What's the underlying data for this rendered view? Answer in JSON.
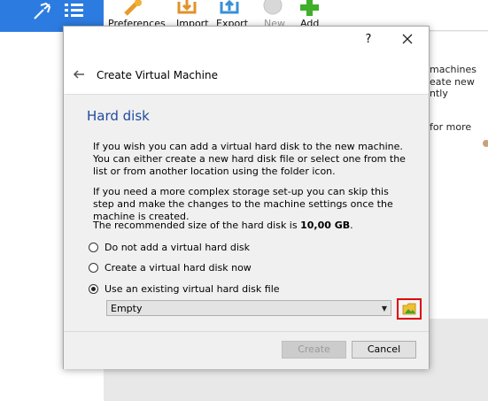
{
  "toolbar": {
    "preferences_label": "Preferences",
    "import_label": "Import",
    "export_label": "Export",
    "new_label": "New",
    "add_label": "Add"
  },
  "background_text": {
    "line1": "machines",
    "line2": "eate new",
    "line3": "ntly",
    "line4": "for more"
  },
  "dialog": {
    "help_label": "?",
    "wizard_title": "Create Virtual Machine",
    "section_title": "Hard disk",
    "paragraph1": "If you wish you can add a virtual hard disk to the new machine. You can either create a new hard disk file or select one from the list or from another location using the folder icon.",
    "paragraph2": "If you need a more complex storage set-up you can skip this step and make the changes to the machine settings once the machine is created.",
    "recommended_prefix": "The recommended size of the hard disk is ",
    "recommended_size": "10,00 GB",
    "recommended_suffix": ".",
    "options": [
      {
        "label": "Do not add a virtual hard disk",
        "checked": false
      },
      {
        "label": "Create a virtual hard disk now",
        "checked": false
      },
      {
        "label": "Use an existing virtual hard disk file",
        "checked": true
      }
    ],
    "disk_select_value": "Empty",
    "create_label": "Create",
    "cancel_label": "Cancel"
  },
  "colors": {
    "tools_pane": "#2c7be0",
    "section_title": "#1f4b9e",
    "highlight": "#e00000"
  }
}
